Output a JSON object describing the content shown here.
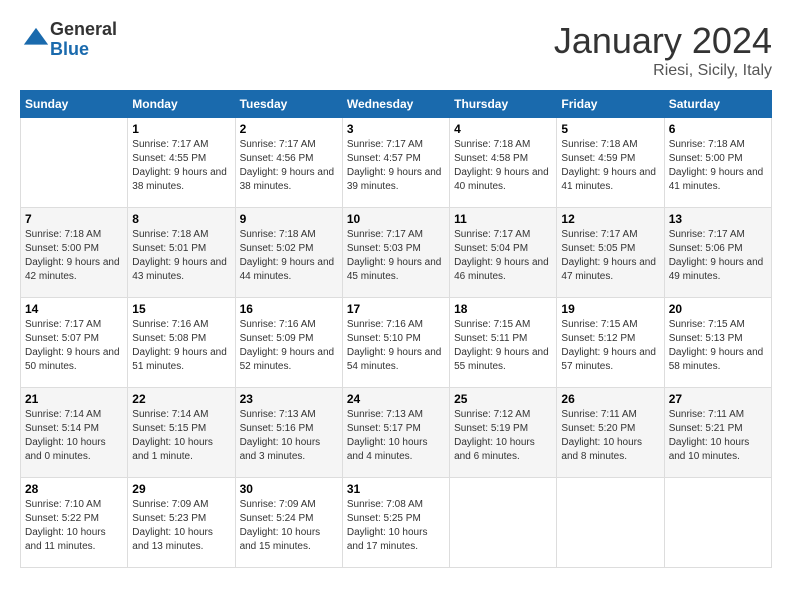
{
  "header": {
    "logo_general": "General",
    "logo_blue": "Blue",
    "month_title": "January 2024",
    "location": "Riesi, Sicily, Italy"
  },
  "weekdays": [
    "Sunday",
    "Monday",
    "Tuesday",
    "Wednesday",
    "Thursday",
    "Friday",
    "Saturday"
  ],
  "weeks": [
    [
      {
        "day": "",
        "sunrise": "",
        "sunset": "",
        "daylight": ""
      },
      {
        "day": "1",
        "sunrise": "7:17 AM",
        "sunset": "4:55 PM",
        "daylight": "9 hours and 38 minutes."
      },
      {
        "day": "2",
        "sunrise": "7:17 AM",
        "sunset": "4:56 PM",
        "daylight": "9 hours and 38 minutes."
      },
      {
        "day": "3",
        "sunrise": "7:17 AM",
        "sunset": "4:57 PM",
        "daylight": "9 hours and 39 minutes."
      },
      {
        "day": "4",
        "sunrise": "7:18 AM",
        "sunset": "4:58 PM",
        "daylight": "9 hours and 40 minutes."
      },
      {
        "day": "5",
        "sunrise": "7:18 AM",
        "sunset": "4:59 PM",
        "daylight": "9 hours and 41 minutes."
      },
      {
        "day": "6",
        "sunrise": "7:18 AM",
        "sunset": "5:00 PM",
        "daylight": "9 hours and 41 minutes."
      }
    ],
    [
      {
        "day": "7",
        "sunrise": "7:18 AM",
        "sunset": "5:00 PM",
        "daylight": "9 hours and 42 minutes."
      },
      {
        "day": "8",
        "sunrise": "7:18 AM",
        "sunset": "5:01 PM",
        "daylight": "9 hours and 43 minutes."
      },
      {
        "day": "9",
        "sunrise": "7:18 AM",
        "sunset": "5:02 PM",
        "daylight": "9 hours and 44 minutes."
      },
      {
        "day": "10",
        "sunrise": "7:17 AM",
        "sunset": "5:03 PM",
        "daylight": "9 hours and 45 minutes."
      },
      {
        "day": "11",
        "sunrise": "7:17 AM",
        "sunset": "5:04 PM",
        "daylight": "9 hours and 46 minutes."
      },
      {
        "day": "12",
        "sunrise": "7:17 AM",
        "sunset": "5:05 PM",
        "daylight": "9 hours and 47 minutes."
      },
      {
        "day": "13",
        "sunrise": "7:17 AM",
        "sunset": "5:06 PM",
        "daylight": "9 hours and 49 minutes."
      }
    ],
    [
      {
        "day": "14",
        "sunrise": "7:17 AM",
        "sunset": "5:07 PM",
        "daylight": "9 hours and 50 minutes."
      },
      {
        "day": "15",
        "sunrise": "7:16 AM",
        "sunset": "5:08 PM",
        "daylight": "9 hours and 51 minutes."
      },
      {
        "day": "16",
        "sunrise": "7:16 AM",
        "sunset": "5:09 PM",
        "daylight": "9 hours and 52 minutes."
      },
      {
        "day": "17",
        "sunrise": "7:16 AM",
        "sunset": "5:10 PM",
        "daylight": "9 hours and 54 minutes."
      },
      {
        "day": "18",
        "sunrise": "7:15 AM",
        "sunset": "5:11 PM",
        "daylight": "9 hours and 55 minutes."
      },
      {
        "day": "19",
        "sunrise": "7:15 AM",
        "sunset": "5:12 PM",
        "daylight": "9 hours and 57 minutes."
      },
      {
        "day": "20",
        "sunrise": "7:15 AM",
        "sunset": "5:13 PM",
        "daylight": "9 hours and 58 minutes."
      }
    ],
    [
      {
        "day": "21",
        "sunrise": "7:14 AM",
        "sunset": "5:14 PM",
        "daylight": "10 hours and 0 minutes."
      },
      {
        "day": "22",
        "sunrise": "7:14 AM",
        "sunset": "5:15 PM",
        "daylight": "10 hours and 1 minute."
      },
      {
        "day": "23",
        "sunrise": "7:13 AM",
        "sunset": "5:16 PM",
        "daylight": "10 hours and 3 minutes."
      },
      {
        "day": "24",
        "sunrise": "7:13 AM",
        "sunset": "5:17 PM",
        "daylight": "10 hours and 4 minutes."
      },
      {
        "day": "25",
        "sunrise": "7:12 AM",
        "sunset": "5:19 PM",
        "daylight": "10 hours and 6 minutes."
      },
      {
        "day": "26",
        "sunrise": "7:11 AM",
        "sunset": "5:20 PM",
        "daylight": "10 hours and 8 minutes."
      },
      {
        "day": "27",
        "sunrise": "7:11 AM",
        "sunset": "5:21 PM",
        "daylight": "10 hours and 10 minutes."
      }
    ],
    [
      {
        "day": "28",
        "sunrise": "7:10 AM",
        "sunset": "5:22 PM",
        "daylight": "10 hours and 11 minutes."
      },
      {
        "day": "29",
        "sunrise": "7:09 AM",
        "sunset": "5:23 PM",
        "daylight": "10 hours and 13 minutes."
      },
      {
        "day": "30",
        "sunrise": "7:09 AM",
        "sunset": "5:24 PM",
        "daylight": "10 hours and 15 minutes."
      },
      {
        "day": "31",
        "sunrise": "7:08 AM",
        "sunset": "5:25 PM",
        "daylight": "10 hours and 17 minutes."
      },
      {
        "day": "",
        "sunrise": "",
        "sunset": "",
        "daylight": ""
      },
      {
        "day": "",
        "sunrise": "",
        "sunset": "",
        "daylight": ""
      },
      {
        "day": "",
        "sunrise": "",
        "sunset": "",
        "daylight": ""
      }
    ]
  ]
}
